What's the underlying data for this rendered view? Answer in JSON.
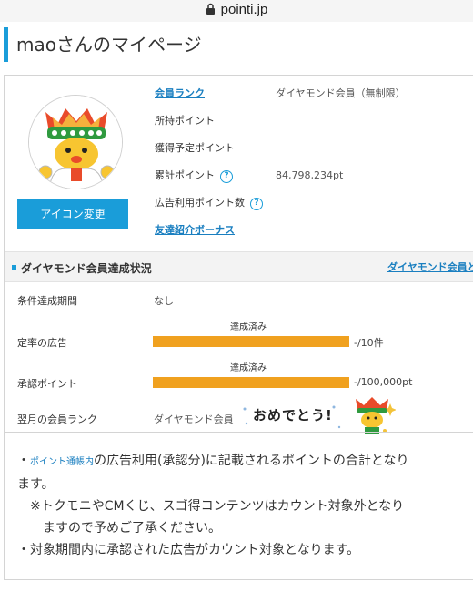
{
  "browser": {
    "url": "pointi.jp"
  },
  "page": {
    "title": "maoさんのマイページ"
  },
  "profile": {
    "icon_change_label": "アイコン変更",
    "rows": [
      {
        "label": "会員ランク",
        "value": "ダイヤモンド会員（無制限）"
      },
      {
        "label": "所持ポイント",
        "value": ""
      },
      {
        "label": "獲得予定ポイント",
        "value": ""
      },
      {
        "label": "累計ポイント",
        "value": "84,798,234pt"
      },
      {
        "label": "広告利用ポイント数",
        "value": ""
      },
      {
        "label": "友達紹介ボーナス",
        "value": ""
      }
    ],
    "help_icon": "question-circle-icon"
  },
  "status": {
    "title": "ダイヤモンド会員達成状況",
    "link": "ダイヤモンド会員と",
    "period_label": "条件達成期間",
    "period_value": "なし",
    "ads": {
      "label": "定率の広告",
      "status": "達成済み",
      "progress_text": "-/10件",
      "progress": 1.0
    },
    "points": {
      "label": "承認ポイント",
      "status": "達成済み",
      "progress_text": "-/100,000pt",
      "progress": 1.0
    },
    "next_label": "翌月の会員ランク",
    "next_value": "ダイヤモンド会員",
    "congrats": "おめでとう!"
  },
  "notes": {
    "note1_prefix": "・",
    "note1_link": "ポイント通帳内",
    "note1_text": "の広告利用(承認分)に記載されるポイントの合計となり",
    "note1_cont": "ます。",
    "note2": "※トクモニやCMくじ、スゴ得コンテンツはカウント対象外となり",
    "note2_cont": "ますので予めご了承ください。",
    "note3_prefix": "・",
    "note3": "対象期間内に承認された広告がカウント対象となります。"
  },
  "colors": {
    "accent": "#1a9dd9",
    "link": "#1a7fc0",
    "bar": "#f0a11f"
  }
}
